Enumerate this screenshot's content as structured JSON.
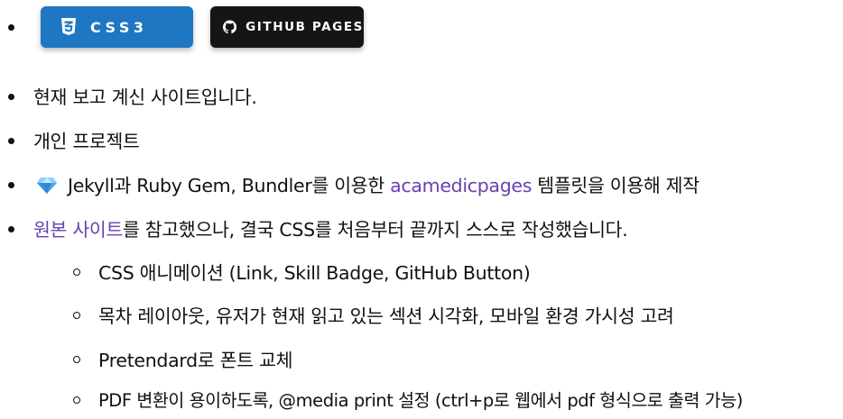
{
  "badges": {
    "css3": {
      "label": "CSS3",
      "icon": "css3-logo-icon",
      "color": "#1f76c2"
    },
    "github_pages": {
      "label": "GITHUB PAGES",
      "icon": "github-logo-icon",
      "color": "#151515"
    }
  },
  "items": {
    "line1": "현재 보고 계신 사이트입니다.",
    "line2": "개인 프로젝트",
    "line3": {
      "icon": "gem-icon",
      "before": "Jekyll과 Ruby Gem, Bundler를 이용한 ",
      "link": "acamedicpages",
      "after": " 템플릿을 이용해 제작"
    },
    "line4": {
      "link": "원본 사이트",
      "after": "를 참고했으나, 결국 CSS를 처음부터 끝까지 스스로 작성했습니다."
    }
  },
  "subitems": {
    "s1": "CSS 애니메이션 (Link, Skill Badge, GitHub Button)",
    "s2": "목차 레이아웃, 유저가 현재 읽고 있는 섹션 시각화, 모바일 환경 가시성 고려",
    "s3": "Pretendard로 폰트 교체",
    "s4": "PDF 변환이 용이하도록, @media print 설정 (ctrl+p로 웹에서 pdf 형식으로 출력 가능)"
  },
  "colors": {
    "link": "#6a3fb3",
    "text": "#111111"
  }
}
